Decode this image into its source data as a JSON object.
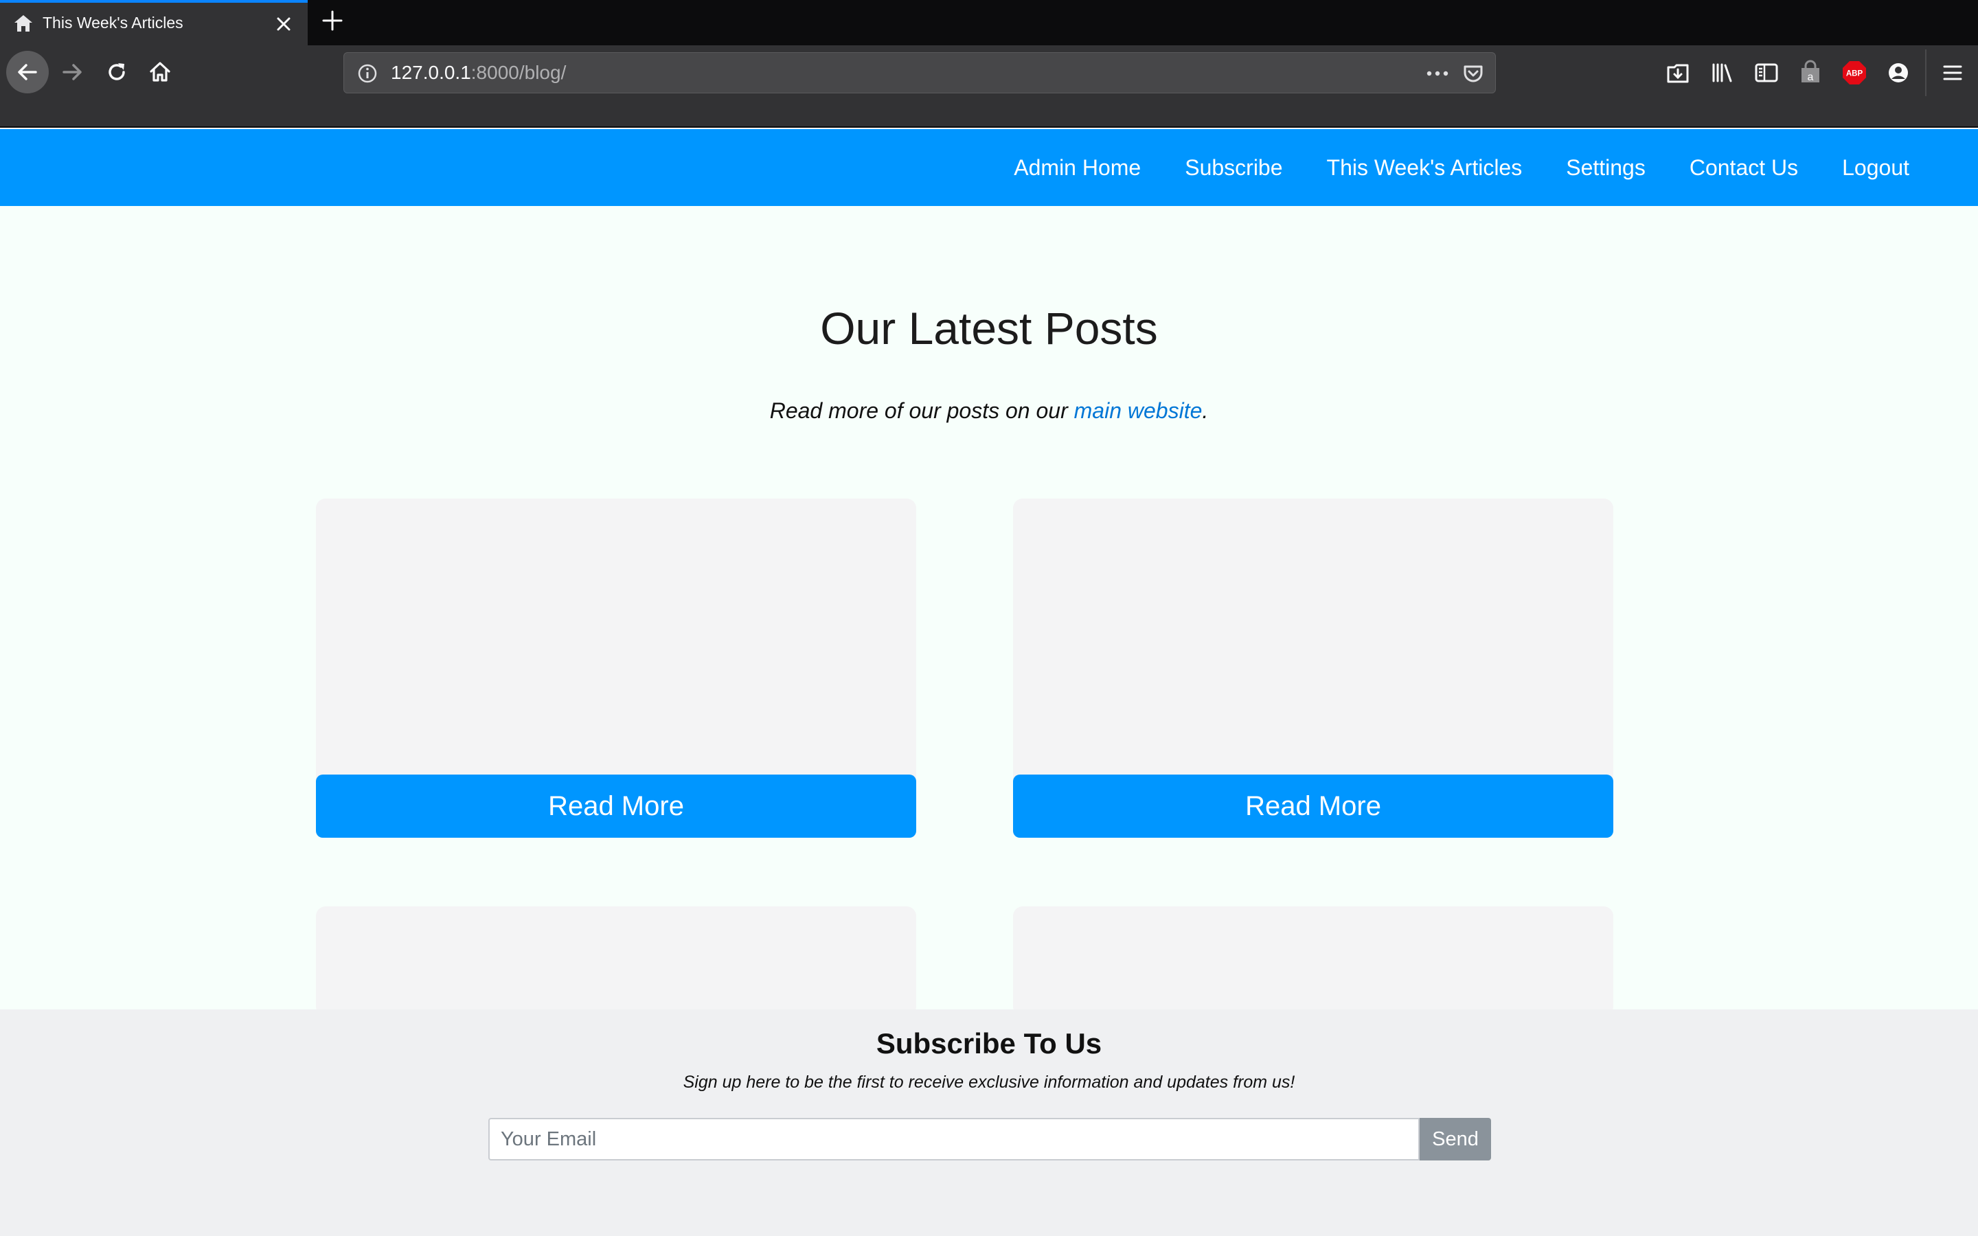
{
  "browser": {
    "tab_title": "This Week's Articles",
    "url_host": "127.0.0.1",
    "url_path": ":8000/blog/",
    "icons": [
      "home-icon",
      "close-icon",
      "plus-icon",
      "back-icon",
      "forward-icon",
      "reload-icon",
      "home-icon",
      "info-icon",
      "more-icon",
      "pocket-icon",
      "downloads-icon",
      "library-icon",
      "sidebar-icon",
      "shopping-bag-icon",
      "adblock-icon",
      "account-icon",
      "menu-icon"
    ],
    "adblock_label": "ABP"
  },
  "site_nav": {
    "items": [
      {
        "label": "Admin Home"
      },
      {
        "label": "Subscribe"
      },
      {
        "label": "This Week's Articles"
      },
      {
        "label": "Settings"
      },
      {
        "label": "Contact Us"
      },
      {
        "label": "Logout"
      }
    ],
    "background": "#0096ff"
  },
  "main": {
    "title": "Our Latest Posts",
    "subtitle_before": "Read more of our posts on our ",
    "subtitle_link": "main website",
    "subtitle_after": ".",
    "cards": [
      {
        "button": "Read More"
      },
      {
        "button": "Read More"
      }
    ]
  },
  "subscribe": {
    "title": "Subscribe To Us",
    "text": "Sign up here to be the first to receive exclusive information and updates from us!",
    "email_placeholder": "Your Email",
    "send_label": "Send"
  }
}
